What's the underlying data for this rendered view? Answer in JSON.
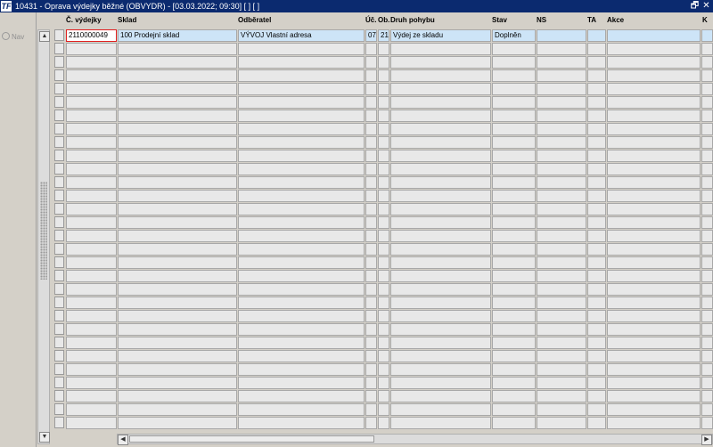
{
  "window": {
    "app_icon": "TF",
    "title": "10431 - Oprava výdejky běžné (OBVYDR) - [03.03.2022; 09:30]  [ ]  [ ]",
    "restore_glyph": "🗗",
    "close_glyph": "✕"
  },
  "nav": {
    "label": "Nav",
    "icon": "nav-icon"
  },
  "grid": {
    "columns": [
      "Č. výdejky",
      "Sklad",
      "Odběratel",
      "Úč.",
      "Ob.",
      "Druh pohybu",
      "Stav",
      "NS",
      "TA",
      "Akce",
      "K"
    ],
    "rows": [
      [
        "2110000049",
        "100 Prodejní sklad",
        "VÝVOJ Vlastní adresa",
        "07",
        "21",
        "Výdej ze skladu",
        "Doplněn",
        "",
        "",
        "",
        ""
      ]
    ],
    "empty_row_count": 29
  },
  "scrollbars": {
    "up": "▲",
    "down": "▼",
    "left": "◀",
    "right": "▶"
  }
}
